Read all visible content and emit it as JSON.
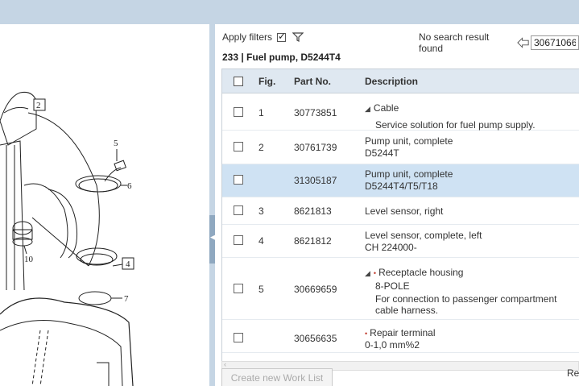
{
  "filters": {
    "apply_label": "Apply filters",
    "apply_checked": true
  },
  "search": {
    "message": "No search result found",
    "value": "30671066"
  },
  "breadcrumb": "233  |  Fuel pump, D5244T4",
  "table": {
    "headers": {
      "fig": "Fig.",
      "part": "Part No.",
      "desc": "Description"
    },
    "rows": [
      {
        "fig": "1",
        "part": "30773851",
        "title": "Cable",
        "triangle": true,
        "sub": "",
        "note": "Service solution for fuel pump supply.",
        "selected": false
      },
      {
        "fig": "2",
        "part": "30761739",
        "title": "Pump unit, complete",
        "sub": "D5244T",
        "note": "",
        "selected": false
      },
      {
        "fig": "",
        "part": "31305187",
        "title": "Pump unit, complete",
        "sub": "D5244T4/T5/T18",
        "note": "",
        "selected": true
      },
      {
        "fig": "3",
        "part": "8621813",
        "title": "Level sensor, right",
        "sub": "",
        "note": "",
        "selected": false
      },
      {
        "fig": "4",
        "part": "8621812",
        "title": "Level sensor, complete, left",
        "sub": "CH 224000-",
        "note": "",
        "selected": false
      },
      {
        "fig": "5",
        "part": "30669659",
        "title": "Receptacle housing",
        "triangle": true,
        "bullet": true,
        "sub": "8-POLE",
        "note": "For connection to passenger compartment cable harness.",
        "selected": false
      },
      {
        "fig": "",
        "part": "30656635",
        "title": "Repair terminal",
        "bullet": true,
        "sub": "0-1,0 mm%2",
        "note": "",
        "selected": false
      }
    ]
  },
  "work_list_button": "Create new Work List",
  "trailing_text": "Re",
  "diagram": {
    "callouts": [
      "2",
      "5",
      "6",
      "10",
      "4",
      "7"
    ]
  },
  "colors": {
    "header_bg": "#dfe8f1",
    "selected_row": "#cfe2f3",
    "chrome": "#c5d5e4"
  }
}
